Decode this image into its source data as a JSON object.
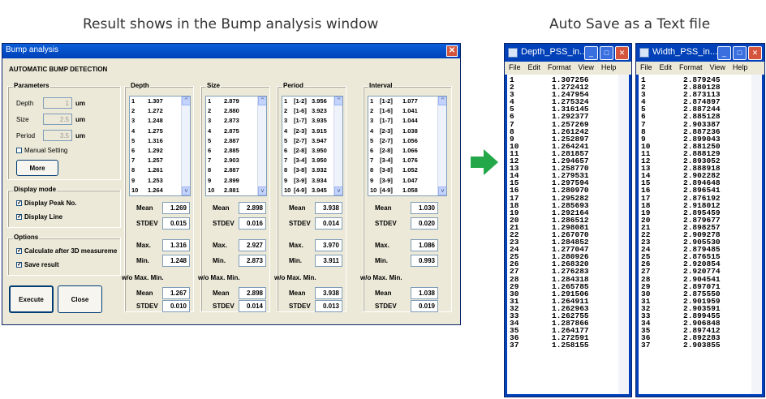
{
  "captions": {
    "left": "Result shows in the Bump analysis window",
    "right": "Auto Save as a Text file"
  },
  "bump": {
    "title": "Bump analysis",
    "close": "✕",
    "heading": "AUTOMATIC BUMP DETECTION",
    "params": {
      "label": "Parameters",
      "depth": "Depth",
      "depth_val": "1",
      "size": "Size",
      "size_val": "2.5",
      "period": "Period",
      "period_val": "3.5",
      "unit": "um",
      "manual": "Manual Setting",
      "more": "More"
    },
    "display": {
      "label": "Display mode",
      "peak": "Display Peak No.",
      "line": "Display Line"
    },
    "options": {
      "label": "Options",
      "calc": "Calculate after 3D measureme",
      "save": "Save result"
    },
    "execute": "Execute",
    "close_btn": "Close",
    "stat_labels": {
      "mean": "Mean",
      "stdev": "STDEV",
      "max": "Max.",
      "min": "Min.",
      "wo": "w/o Max. Min."
    },
    "columns": [
      {
        "label": "Depth",
        "rows": [
          [
            "1",
            "1.307"
          ],
          [
            "2",
            "1.272"
          ],
          [
            "3",
            "1.248"
          ],
          [
            "4",
            "1.275"
          ],
          [
            "5",
            "1.316"
          ],
          [
            "6",
            "1.292"
          ],
          [
            "7",
            "1.257"
          ],
          [
            "8",
            "1.261"
          ],
          [
            "9",
            "1.253"
          ],
          [
            "10",
            "1.264"
          ]
        ],
        "mean": "1.269",
        "stdev": "0.015",
        "max": "1.316",
        "min": "1.248",
        "wo_mean": "1.267",
        "wo_stdev": "0.010"
      },
      {
        "label": "Size",
        "rows": [
          [
            "1",
            "2.879"
          ],
          [
            "2",
            "2.880"
          ],
          [
            "3",
            "2.873"
          ],
          [
            "4",
            "2.875"
          ],
          [
            "5",
            "2.887"
          ],
          [
            "6",
            "2.885"
          ],
          [
            "7",
            "2.903"
          ],
          [
            "8",
            "2.887"
          ],
          [
            "9",
            "2.899"
          ],
          [
            "10",
            "2.881"
          ]
        ],
        "mean": "2.898",
        "stdev": "0.016",
        "max": "2.927",
        "min": "2.873",
        "wo_mean": "2.898",
        "wo_stdev": "0.014"
      },
      {
        "label": "Period",
        "rows": [
          [
            "1",
            "[1-2]",
            "3.956"
          ],
          [
            "2",
            "[1-6]",
            "3.923"
          ],
          [
            "3",
            "[1-7]",
            "3.935"
          ],
          [
            "4",
            "[2-3]",
            "3.915"
          ],
          [
            "5",
            "[2-7]",
            "3.947"
          ],
          [
            "6",
            "[2-8]",
            "3.950"
          ],
          [
            "7",
            "[3-4]",
            "3.950"
          ],
          [
            "8",
            "[3-8]",
            "3.932"
          ],
          [
            "9",
            "[3-9]",
            "3.934"
          ],
          [
            "10",
            "[4-9]",
            "3.945"
          ]
        ],
        "mean": "3.938",
        "stdev": "0.014",
        "max": "3.970",
        "min": "3.911",
        "wo_mean": "3.938",
        "wo_stdev": "0.013"
      },
      {
        "label": "Interval",
        "rows": [
          [
            "1",
            "[1-2]",
            "1.077"
          ],
          [
            "2",
            "[1-6]",
            "1.041"
          ],
          [
            "3",
            "[1-7]",
            "1.044"
          ],
          [
            "4",
            "[2-3]",
            "1.038"
          ],
          [
            "5",
            "[2-7]",
            "1.056"
          ],
          [
            "6",
            "[2-8]",
            "1.066"
          ],
          [
            "7",
            "[3-4]",
            "1.076"
          ],
          [
            "8",
            "[3-8]",
            "1.052"
          ],
          [
            "9",
            "[3-9]",
            "1.047"
          ],
          [
            "10",
            "[4-9]",
            "1.058"
          ]
        ],
        "mean": "1.030",
        "stdev": "0.020",
        "max": "1.086",
        "min": "0.993",
        "wo_mean": "1.038",
        "wo_stdev": "0.019"
      }
    ]
  },
  "notepads": [
    {
      "title": "Depth_PSS_in...",
      "menu": [
        "File",
        "Edit",
        "Format",
        "View",
        "Help"
      ],
      "rows": [
        [
          "1",
          "1.307256"
        ],
        [
          "2",
          "1.272412"
        ],
        [
          "3",
          "1.247954"
        ],
        [
          "4",
          "1.275324"
        ],
        [
          "5",
          "1.316145"
        ],
        [
          "6",
          "1.292377"
        ],
        [
          "7",
          "1.257269"
        ],
        [
          "8",
          "1.261242"
        ],
        [
          "9",
          "1.252897"
        ],
        [
          "10",
          "1.264241"
        ],
        [
          "11",
          "1.281857"
        ],
        [
          "12",
          "1.294657"
        ],
        [
          "13",
          "1.258770"
        ],
        [
          "14",
          "1.279531"
        ],
        [
          "15",
          "1.297594"
        ],
        [
          "16",
          "1.280970"
        ],
        [
          "17",
          "1.295282"
        ],
        [
          "18",
          "1.285693"
        ],
        [
          "19",
          "1.292164"
        ],
        [
          "20",
          "1.286512"
        ],
        [
          "21",
          "1.298081"
        ],
        [
          "22",
          "1.267070"
        ],
        [
          "23",
          "1.284852"
        ],
        [
          "24",
          "1.277047"
        ],
        [
          "25",
          "1.280926"
        ],
        [
          "26",
          "1.268320"
        ],
        [
          "27",
          "1.276283"
        ],
        [
          "28",
          "1.284318"
        ],
        [
          "29",
          "1.265785"
        ],
        [
          "30",
          "1.291506"
        ],
        [
          "31",
          "1.264911"
        ],
        [
          "32",
          "1.262963"
        ],
        [
          "33",
          "1.262755"
        ],
        [
          "34",
          "1.287866"
        ],
        [
          "35",
          "1.264177"
        ],
        [
          "36",
          "1.272591"
        ],
        [
          "37",
          "1.258155"
        ]
      ]
    },
    {
      "title": "Width_PSS_in...",
      "menu": [
        "File",
        "Edit",
        "Format",
        "View",
        "Help"
      ],
      "rows": [
        [
          "1",
          "2.879245"
        ],
        [
          "2",
          "2.880128"
        ],
        [
          "3",
          "2.873113"
        ],
        [
          "4",
          "2.874897"
        ],
        [
          "5",
          "2.887244"
        ],
        [
          "6",
          "2.885128"
        ],
        [
          "7",
          "2.903387"
        ],
        [
          "8",
          "2.887236"
        ],
        [
          "9",
          "2.899043"
        ],
        [
          "10",
          "2.881250"
        ],
        [
          "11",
          "2.888129"
        ],
        [
          "12",
          "2.893052"
        ],
        [
          "13",
          "2.888918"
        ],
        [
          "14",
          "2.902282"
        ],
        [
          "15",
          "2.894648"
        ],
        [
          "16",
          "2.896541"
        ],
        [
          "17",
          "2.876192"
        ],
        [
          "18",
          "2.918012"
        ],
        [
          "19",
          "2.895459"
        ],
        [
          "20",
          "2.879677"
        ],
        [
          "21",
          "2.898257"
        ],
        [
          "22",
          "2.909278"
        ],
        [
          "23",
          "2.905530"
        ],
        [
          "24",
          "2.879485"
        ],
        [
          "25",
          "2.876515"
        ],
        [
          "26",
          "2.920854"
        ],
        [
          "27",
          "2.920774"
        ],
        [
          "28",
          "2.904541"
        ],
        [
          "29",
          "2.897071"
        ],
        [
          "30",
          "2.875550"
        ],
        [
          "31",
          "2.901959"
        ],
        [
          "32",
          "2.903591"
        ],
        [
          "33",
          "2.899455"
        ],
        [
          "34",
          "2.906848"
        ],
        [
          "35",
          "2.897412"
        ],
        [
          "36",
          "2.892283"
        ],
        [
          "37",
          "2.903855"
        ]
      ]
    }
  ],
  "colors": {
    "arrow": "#22a849",
    "titlebar": "#0a5fd8"
  }
}
